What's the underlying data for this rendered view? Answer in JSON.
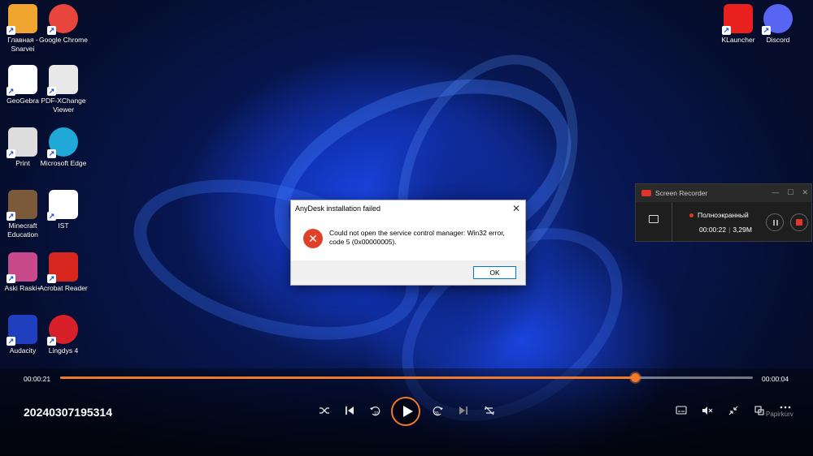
{
  "desktop": {
    "icons": [
      {
        "label": "Главная - Snarvei",
        "icon": "home-folder-icon",
        "color": "#f0a430"
      },
      {
        "label": "Google Chrome",
        "icon": "chrome-icon",
        "color": "#e8453c"
      },
      {
        "label": "GeoGebra",
        "icon": "geogebra-icon",
        "color": "#ffffff"
      },
      {
        "label": "PDF-XChange Viewer",
        "icon": "pdf-xchange-icon",
        "color": "#e8e8e8"
      },
      {
        "label": "Print",
        "icon": "printer-icon",
        "color": "#dddddd"
      },
      {
        "label": "Microsoft Edge",
        "icon": "edge-icon",
        "color": "#1fa8d8"
      },
      {
        "label": "Minecraft Education",
        "icon": "minecraft-icon",
        "color": "#7a5a3a"
      },
      {
        "label": "IST",
        "icon": "blank-file-icon",
        "color": "#ffffff"
      },
      {
        "label": "Aski Raski+",
        "icon": "aski-raski-icon",
        "color": "#c84a8a"
      },
      {
        "label": "Acrobat Reader",
        "icon": "acrobat-icon",
        "color": "#d7261e"
      },
      {
        "label": "Audacity",
        "icon": "audacity-icon",
        "color": "#1f3fbf"
      },
      {
        "label": "Lingdys 4",
        "icon": "lingdys-icon",
        "color": "#d8202a"
      },
      {
        "label": "KLauncher",
        "icon": "klauncher-icon",
        "color": "#e8201e"
      },
      {
        "label": "Discord",
        "icon": "discord-icon",
        "color": "#5865f2"
      }
    ],
    "shortcut_arrow": "↗",
    "recycle_bin_label": "Papirkurv"
  },
  "dialog": {
    "title": "AnyDesk installation failed",
    "close_symbol": "✕",
    "error_symbol": "✕",
    "message": "Could not open the service control manager:  Win32 error, code 5 (0x00000005).",
    "ok_label": "OK"
  },
  "recorder": {
    "title": "Screen Recorder",
    "mode": "Полноэкранный",
    "elapsed": "00:00:22",
    "size": "3,29M",
    "separator": "|",
    "minimize_symbol": "—",
    "maximize_symbol": "☐",
    "close_symbol": "✕"
  },
  "player": {
    "current_time": "00:00:21",
    "total_time": "00:00:04",
    "progress": 0.83,
    "filename": "20240307195314",
    "accent_color": "#f07a2a"
  }
}
